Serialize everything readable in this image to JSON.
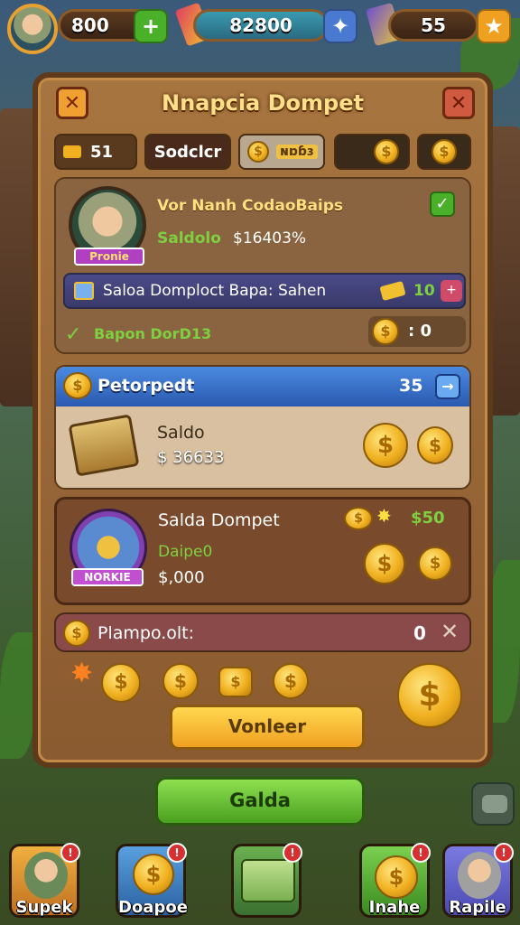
{
  "topbar": {
    "level": "800",
    "gems": "82800",
    "stars": "55"
  },
  "panel": {
    "title": "Nnapcia Dompet",
    "tabs": [
      {
        "label": "51"
      },
      {
        "label": "Sodclcr"
      },
      {
        "label": "ɴɒɓɜ"
      }
    ]
  },
  "profile": {
    "name": "Vor Nanh CodaoBaips",
    "saldo_label": "Saldolo",
    "saldo_value": "$16403%",
    "ribbon": "Pronie",
    "bar_text": "Saloa Domploct Bapa: Sahen",
    "bar_value": "10",
    "link_text": "Bapon DorD13",
    "link_value": ": 0"
  },
  "section1": {
    "header": "Petorpedt",
    "header_value": "35",
    "saldo_label": "Saldo",
    "saldo_value": "$ 36633"
  },
  "section2": {
    "title": "Salda Dompet",
    "reward": "$50",
    "sub_label": "Daipe0",
    "sub_value": "$,000",
    "badge": "NORKIE"
  },
  "plampo": {
    "label": "Plampo.olt:",
    "value": "0"
  },
  "buttons": {
    "vanleer": "Vonleer",
    "galda": "Galda"
  },
  "bottom_nav": [
    {
      "label": "Supek"
    },
    {
      "label": "Doapoe"
    },
    {
      "label": ""
    },
    {
      "label": "Inahe"
    },
    {
      "label": "Rapile"
    }
  ],
  "colors": {
    "panel": "#a7753f",
    "header_blue": "#3a7ad0",
    "green": "#6cc040",
    "gold": "#f0b020"
  }
}
